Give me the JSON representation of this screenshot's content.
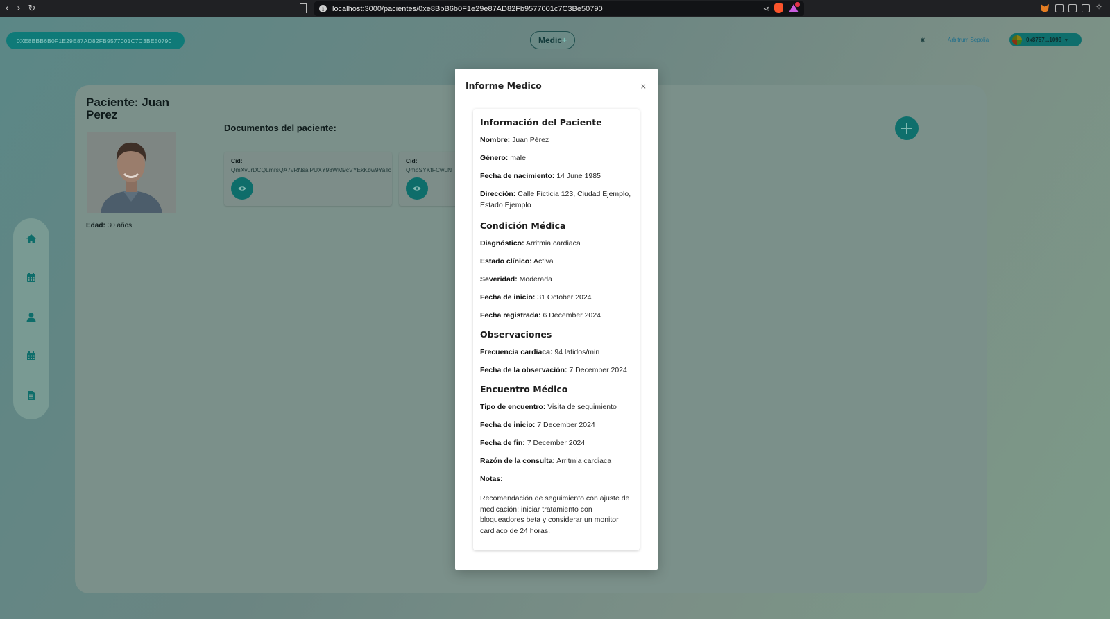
{
  "browser": {
    "url": "localhost:3000/pacientes/0xe8BbB6b0F1e29e87AD82Fb9577001c7C3Be50790"
  },
  "header": {
    "wallet_address": "0XE8BBB6B0F1E29E87AD82FB9577001C7C3BE50790",
    "logo_text": "Medic",
    "logo_plus": "+",
    "network": "Arbitrum Sepolia",
    "account": "0x8757...1099"
  },
  "sidebar": {
    "items": [
      {
        "icon": "home-icon"
      },
      {
        "icon": "calendar-icon"
      },
      {
        "icon": "user-icon"
      },
      {
        "icon": "calendar-icon"
      },
      {
        "icon": "document-icon"
      }
    ]
  },
  "patient": {
    "title": "Paciente: Juan Perez",
    "age_label": "Edad:",
    "age_value": "30 años"
  },
  "documents": {
    "title": "Documentos del paciente:",
    "items": [
      {
        "cid_label": "Cid:",
        "cid": "QmXvurDCQLmrsQA7vRNsaiPUXY98WM9cVYEkKbw9YaTc"
      },
      {
        "cid_label": "Cid:",
        "cid": "QmbSYKfFCwLN"
      }
    ]
  },
  "modal": {
    "title": "Informe Medico",
    "close": "×",
    "sections": {
      "patient_info": "Información del Paciente",
      "condition": "Condición Médica",
      "observations": "Observaciones",
      "encounter": "Encuentro Médico"
    },
    "fields": {
      "nombre": {
        "label": "Nombre:",
        "value": "Juan Pérez"
      },
      "genero": {
        "label": "Género:",
        "value": "male"
      },
      "nacimiento": {
        "label": "Fecha de nacimiento:",
        "value": "14 June 1985"
      },
      "direccion": {
        "label": "Dirección:",
        "value": "Calle Ficticia 123, Ciudad Ejemplo, Estado Ejemplo"
      },
      "diagnostico": {
        "label": "Diagnóstico:",
        "value": "Arritmia cardiaca"
      },
      "estado": {
        "label": "Estado clínico:",
        "value": "Activa"
      },
      "severidad": {
        "label": "Severidad:",
        "value": "Moderada"
      },
      "inicio_cond": {
        "label": "Fecha de inicio:",
        "value": "31 October 2024"
      },
      "registrada": {
        "label": "Fecha registrada:",
        "value": "6 December 2024"
      },
      "frecuencia": {
        "label": "Frecuencia cardiaca:",
        "value": "94 latidos/min"
      },
      "fecha_obs": {
        "label": "Fecha de la observación:",
        "value": "7 December 2024"
      },
      "tipo": {
        "label": "Tipo de encuentro:",
        "value": "Visita de seguimiento"
      },
      "inicio_enc": {
        "label": "Fecha de inicio:",
        "value": "7 December 2024"
      },
      "fin": {
        "label": "Fecha de fin:",
        "value": "7 December 2024"
      },
      "razon": {
        "label": "Razón de la consulta:",
        "value": "Arritmia cardiaca"
      },
      "notas": {
        "label": "Notas:",
        "value": "Recomendación de seguimiento con ajuste de medicación: iniciar tratamiento con bloqueadores beta y considerar un monitor cardiaco de 24 horas."
      }
    }
  },
  "colors": {
    "accent": "#0f6f6c",
    "modal_bg": "#ffffff"
  }
}
